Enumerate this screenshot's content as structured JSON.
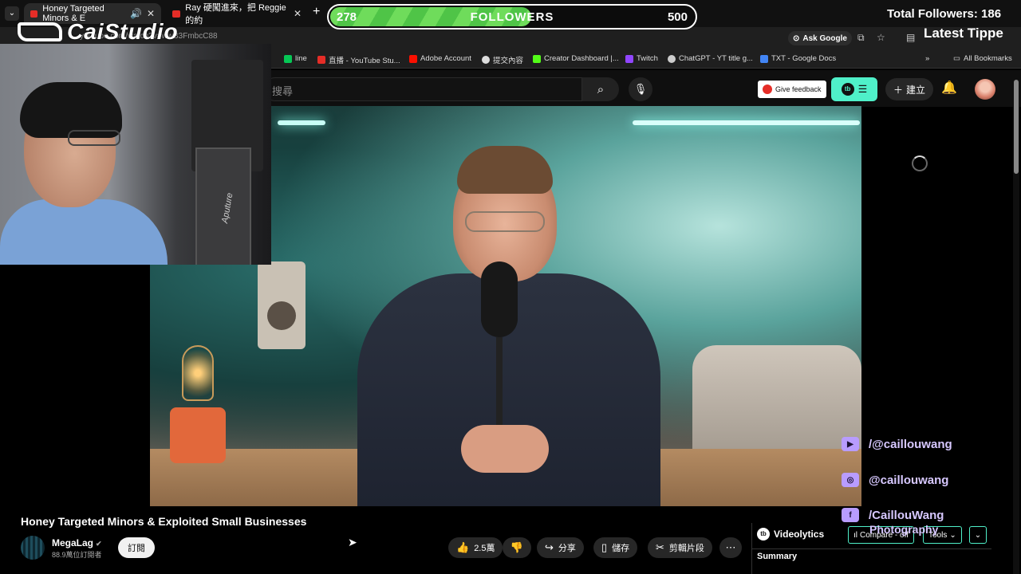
{
  "browser": {
    "tabs": [
      {
        "title": "Honey Targeted Minors & E",
        "active": true
      },
      {
        "title": "Ray 硬闖進來，把 Reggie 的約",
        "active": false
      }
    ],
    "url": "youtube.com/watch?v=wwB3FmbcC88",
    "ask_google": "Ask Google",
    "bookmarks": [
      "line",
      "直播 - YouTube Stu...",
      "Adobe Account",
      "提交內容",
      "Creator Dashboard |...",
      "Twitch",
      "ChatGPT - YT title g...",
      "TXT - Google Docs"
    ],
    "all_bookmarks": "All Bookmarks"
  },
  "youtube": {
    "search_placeholder": "搜尋",
    "give_feedback": "Give feedback",
    "create_label": "建立"
  },
  "video": {
    "title": "Honey Targeted Minors & Exploited Small Businesses",
    "channel": "MegaLag",
    "subscribers": "88.9萬位訂閱者",
    "subscribe": "訂閱",
    "likes": "2.5萬",
    "share": "分享",
    "save": "儲存",
    "clip": "剪輯片段"
  },
  "overlay": {
    "logo_text": "CaiStudio",
    "followers_current": "278",
    "followers_label": "FOLLOWERS",
    "followers_goal": "500",
    "followers_progress": 0.556,
    "total_followers": "Total Followers: 186",
    "latest_tipper": "Latest Tippe",
    "cam_brand": "Aputure",
    "socials": [
      {
        "icon": "youtube-icon",
        "handle": "/@caillouwang"
      },
      {
        "icon": "instagram-icon",
        "handle": "@caillouwang"
      },
      {
        "icon": "facebook-icon",
        "handle": "/CaillouWang"
      }
    ],
    "photography": "Photography"
  },
  "videolytics": {
    "title": "Videolytics",
    "compare": "Compare - off",
    "tools": "Tools",
    "summary": "Summary"
  },
  "colors": {
    "accent": "#4ff0c9",
    "progress": "#6fdc5b",
    "social": "#d7c8ff",
    "youtube_red": "#e52d27"
  }
}
